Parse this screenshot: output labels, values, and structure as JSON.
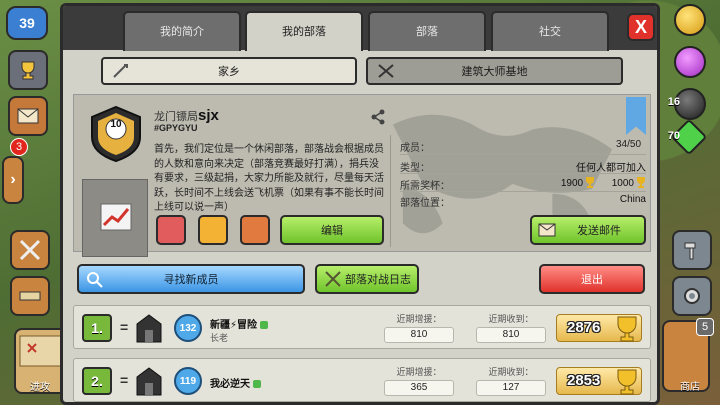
{
  "hud": {
    "level": "39",
    "mail_badge": "3",
    "attack_label": "进攻",
    "shop_label": "商店",
    "shop_badge": "5",
    "dark_elixir_num": "16",
    "gem_num": "70"
  },
  "tabs": [
    {
      "label": "我的简介"
    },
    {
      "label": "我的部落"
    },
    {
      "label": "部落"
    },
    {
      "label": "社交"
    }
  ],
  "close_label": "X",
  "sub_tabs": {
    "home": "家乡",
    "builder": "建筑大师基地"
  },
  "clan": {
    "prefix": "龙门镖局",
    "name": "sjx",
    "tag": "#GPYGYU",
    "level": "10",
    "description": "首先，我们定位是一个休闲部落，部落战会根据成员的人数和意向来决定（部落竞赛最好打满），捐兵没有要求，三级起捐，大家力所能及就行，尽量每天活跃，长时间不上线会送飞机票（如果有事不能长时间上线可以说一声）",
    "members_label": "成员：",
    "members_value": "34/50",
    "type_label": "类型：",
    "type_value": "任何人都可加入",
    "trophies_label": "所需奖杯：",
    "trophies_value_1": "1900",
    "trophies_value_2": "1000",
    "location_label": "部落位置：",
    "location_value": "China",
    "edit_label": "编辑",
    "send_mail_label": "发送邮件"
  },
  "actions": {
    "find_members": "寻找新成员",
    "war_log": "部落对战日志",
    "leave": "退出"
  },
  "member_headers": {
    "donated": "近期增援：",
    "received": "近期收到："
  },
  "members": [
    {
      "rank": "1.",
      "rank_change": "=",
      "xp": "132",
      "name": "新疆⚡冒险",
      "role": "长老",
      "donated": "810",
      "received": "810",
      "trophies": "2876"
    },
    {
      "rank": "2.",
      "rank_change": "=",
      "xp": "119",
      "name": "我必逆天",
      "role": "",
      "donated": "365",
      "received": "127",
      "trophies": "2853"
    }
  ],
  "colors": {
    "accent_green": "#6fc42b",
    "accent_blue": "#3b95e4",
    "accent_red": "#e0322b",
    "panel": "#d3d2c8"
  }
}
